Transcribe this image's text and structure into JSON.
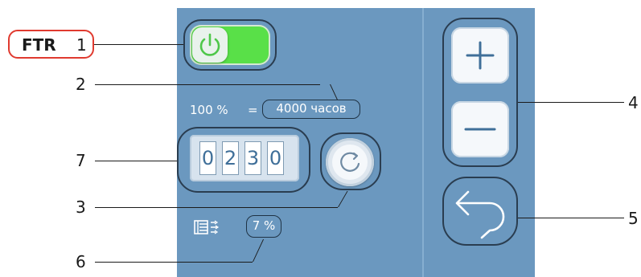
{
  "ftr_label": {
    "name": "FTR",
    "number": "1"
  },
  "callouts": {
    "c1": "1",
    "c2": "2",
    "c3": "3",
    "c4": "4",
    "c5": "5",
    "c6": "6",
    "c7": "7"
  },
  "power_toggle": {
    "state": "on",
    "icon": "power-icon",
    "accent": "#59e048"
  },
  "ratio": {
    "percent": "100 %",
    "equals": "=",
    "hours": "4000 часов"
  },
  "counter": {
    "digits": [
      "0",
      "2",
      "3",
      "0"
    ]
  },
  "reset_button": {
    "icon": "refresh-icon"
  },
  "filter": {
    "icon": "filter-icon",
    "percent": "7 %"
  },
  "buttons": {
    "plus_icon": "plus-icon",
    "minus_icon": "minus-icon",
    "back_icon": "back-arrow-icon"
  },
  "colors": {
    "panel": "#6b98bf",
    "frame": "#2a3d50",
    "ftr_border": "#e03a2f",
    "digit_text": "#3f6f99"
  }
}
